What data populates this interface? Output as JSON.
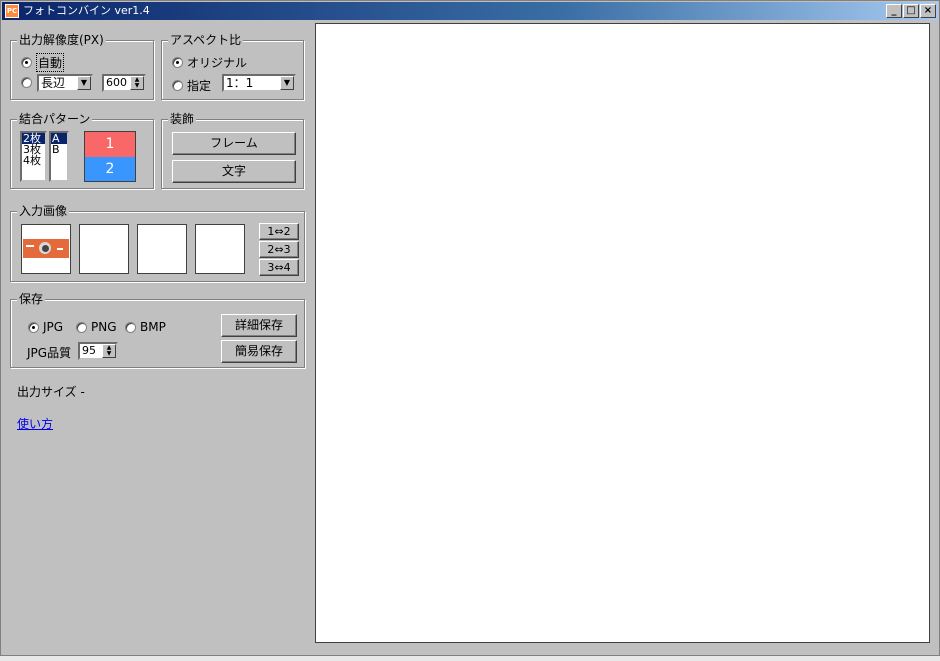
{
  "window": {
    "title": "フォトコンバイン ver1.4",
    "icon_text": "PC"
  },
  "titlebar_buttons": {
    "minimize": "_",
    "maximize": "□",
    "close": "×"
  },
  "resolution": {
    "legend": "出力解像度(PX)",
    "auto_label": "自動",
    "manual_select_value": "長辺",
    "manual_value": "600"
  },
  "aspect": {
    "legend": "アスペクト比",
    "original_label": "オリジナル",
    "specify_label": "指定",
    "ratio_value": "1：1"
  },
  "pattern": {
    "legend": "結合パターン",
    "counts": [
      "2枚",
      "3枚",
      "4枚"
    ],
    "variants": [
      "A",
      "B"
    ],
    "preview": [
      "1",
      "2"
    ],
    "colors": {
      "top": "#f86868",
      "bottom": "#3a96ff"
    }
  },
  "decoration": {
    "legend": "装飾",
    "frame_button": "フレーム",
    "text_button": "文字"
  },
  "input": {
    "legend": "入力画像",
    "swap_buttons": [
      "1⇔2",
      "2⇔3",
      "3⇔4"
    ]
  },
  "save": {
    "legend": "保存",
    "formats": [
      "JPG",
      "PNG",
      "BMP"
    ],
    "quality_label": "JPG品質",
    "quality_value": "95",
    "detail_button": "詳細保存",
    "quick_button": "簡易保存"
  },
  "output_size_label": "出力サイズ -",
  "help_link": "使い方"
}
